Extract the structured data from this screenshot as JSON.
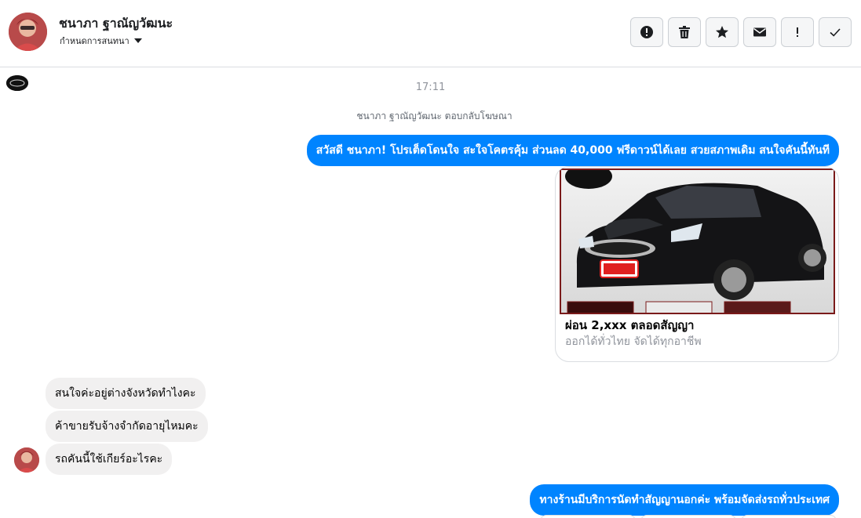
{
  "header": {
    "contact_name": "ชนาภา ฐาณัญวัฒนะ",
    "assign_label": "กำหนดการสนทนา"
  },
  "actions": [
    {
      "name": "alert-button",
      "icon": "alert-circle-icon"
    },
    {
      "name": "delete-button",
      "icon": "trash-icon"
    },
    {
      "name": "star-button",
      "icon": "star-icon"
    },
    {
      "name": "mark-unread-button",
      "icon": "envelope-icon"
    },
    {
      "name": "important-button",
      "icon": "exclamation-icon"
    },
    {
      "name": "done-button",
      "icon": "check-icon"
    }
  ],
  "conversation": {
    "time": "17:11",
    "ad_reply_note": "ชนาภา ฐาณัญวัฒนะ ตอบกลับโฆษณา",
    "messages_out": [
      "สวัสดี ชนาภา! โปรเต็ดโดนใจ สะใจโคตรคุ้ม ส่วนลด 40,000 ฟรีดาวน์ได้เลย สวยสภาพเดิม สนใจคันนี้ทันที",
      "ทางร้านมีบริการนัดทำสัญญานอกค่ะ พร้อมจัดส่งรถทั่วประเทศ"
    ],
    "card": {
      "title": "ผ่อน 2,xxx ตลอดสัญญา",
      "subtitle": "ออกได้ทั่วไทย จัดได้ทุกอาชีพ"
    },
    "messages_in": [
      "สนใจค่ะอยู่ต่างจังหวัดทำไงคะ",
      "ค้าขายรับจ้างจำกัดอายุไหมคะ",
      "รถคันนี้ใช้เกียร์อะไรคะ"
    ]
  },
  "colors": {
    "accent": "#0084ff",
    "incoming_bubble": "#f1f0f0"
  }
}
